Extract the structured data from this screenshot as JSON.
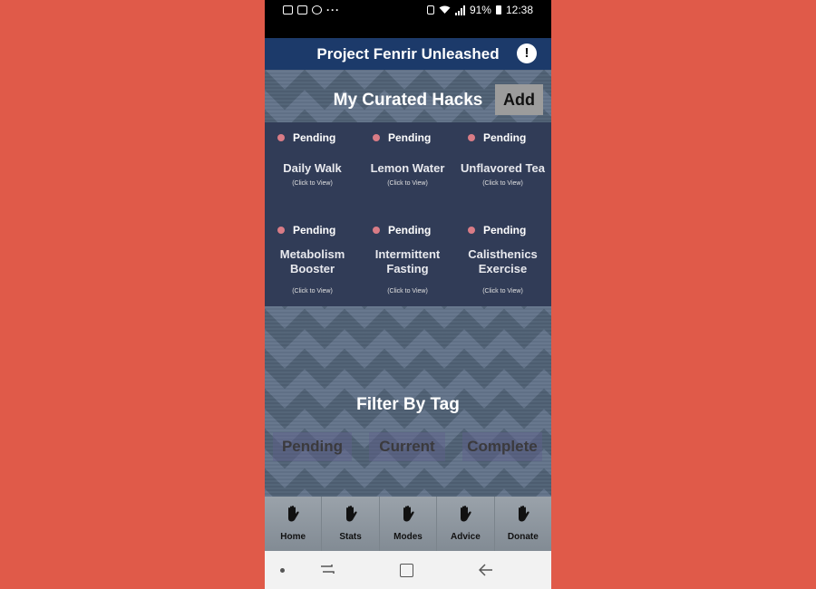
{
  "status_bar": {
    "battery": "91%",
    "time": "12:38",
    "dots": "···"
  },
  "app_bar": {
    "title": "Project Fenrir Unleashed",
    "alert_glyph": "!"
  },
  "hacks": {
    "title": "My Curated Hacks",
    "add_label": "Add",
    "cards": [
      {
        "status": "Pending",
        "name": "Daily Walk",
        "hint": "(Click to View)"
      },
      {
        "status": "Pending",
        "name": "Lemon Water",
        "hint": "(Click to View)"
      },
      {
        "status": "Pending",
        "name": "Unflavored Tea",
        "hint": "(Click to View)"
      },
      {
        "status": "Pending",
        "name": "Metabolism Booster",
        "hint": "(Click to View)"
      },
      {
        "status": "Pending",
        "name": "Intermittent Fasting",
        "hint": "(Click to View)"
      },
      {
        "status": "Pending",
        "name": "Calisthenics Exercise",
        "hint": "(Click to View)"
      }
    ]
  },
  "filter": {
    "title": "Filter By Tag",
    "tags": [
      "Pending",
      "Current",
      "Complete"
    ]
  },
  "bottom_nav": {
    "items": [
      "Home",
      "Stats",
      "Modes",
      "Advice",
      "Donate"
    ]
  },
  "colors": {
    "page_background": "#e05a49",
    "app_bar": "#1c3a6a",
    "card_panel": "#313c57",
    "pending_dot": "#d97c86"
  }
}
